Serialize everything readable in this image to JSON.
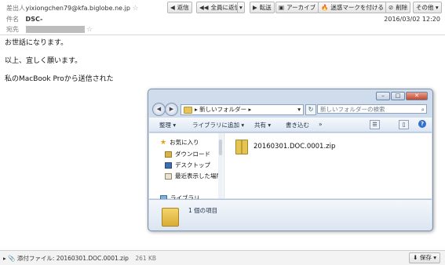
{
  "header": {
    "from_label": "差出人",
    "from_value": "yixiongchen79@kfa.biglobe.ne.jp",
    "subject_label": "件名",
    "subject_value": "DSC-",
    "to_label": "宛先",
    "date": "2016/03/02 12:20"
  },
  "toolbar": {
    "reply": "返信",
    "reply_all": "全員に返信",
    "forward": "転送",
    "archive": "アーカイブ",
    "junk": "迷惑マークを付ける",
    "delete": "削除",
    "other": "その他"
  },
  "body": {
    "line1": "お世話になります。",
    "line2": "以上、宜しく願います。",
    "line3": "私のMacBook Proから送信された"
  },
  "explorer": {
    "address_path": "新しいフォルダー",
    "search_placeholder": "新しいフォルダーの検索",
    "commands": {
      "organize": "整理",
      "add_to_library": "ライブラリに追加",
      "share": "共有",
      "burn": "書き込む",
      "more": "»"
    },
    "nav": {
      "favorites": "お気に入り",
      "downloads": "ダウンロード",
      "desktop": "デスクトップ",
      "recent": "最近表示した場所",
      "libraries": "ライブラリ"
    },
    "file_name": "20160301.DOC.0001.zip",
    "item_count": "1 個の項目"
  },
  "footer": {
    "attachment_label": "添付ファイル: 20160301.DOC.0001.zip",
    "attachment_size": "261 KB",
    "save": "保存"
  }
}
